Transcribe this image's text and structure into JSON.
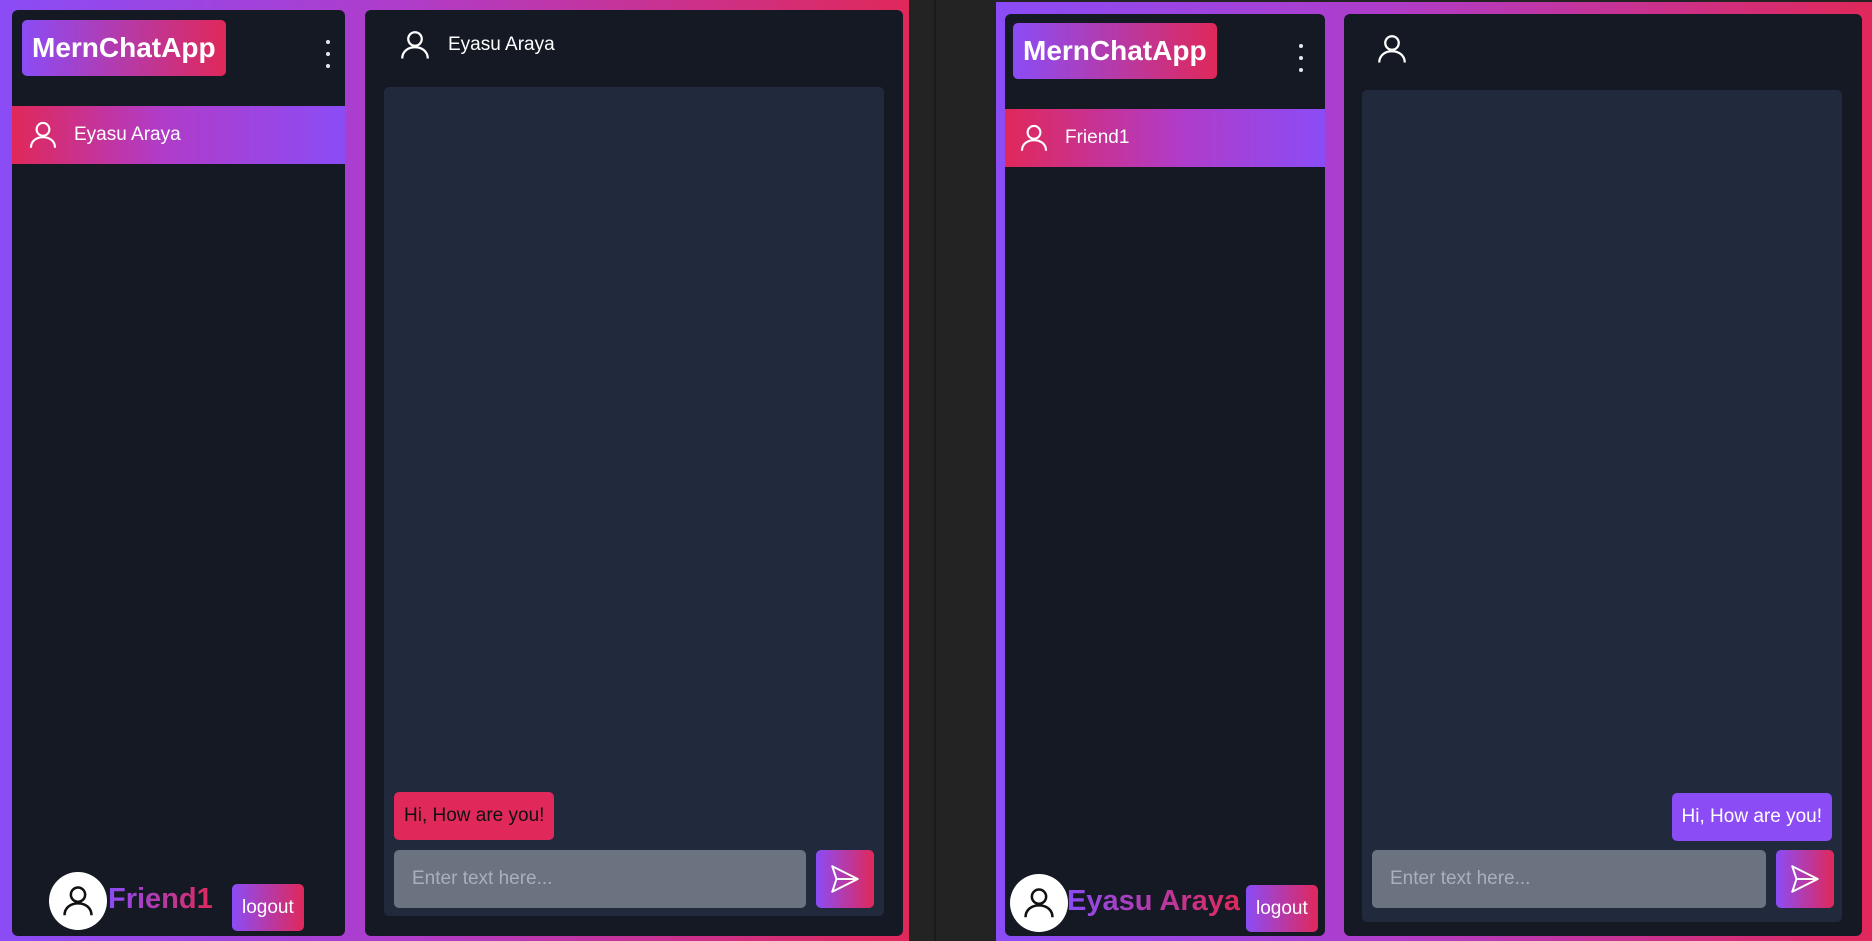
{
  "app_name": "MernChatApp",
  "left_window": {
    "contacts": [
      {
        "name": "Eyasu Araya"
      }
    ],
    "chat": {
      "header_name": "Eyasu Araya",
      "messages": [
        {
          "text": "Hi, How are you!",
          "direction": "received"
        }
      ],
      "input_placeholder": "Enter text here..."
    },
    "current_user": "Friend1",
    "logout_label": "logout"
  },
  "right_window": {
    "contacts": [
      {
        "name": "Friend1"
      }
    ],
    "chat": {
      "header_name": "",
      "messages": [
        {
          "text": "Hi, How are you!",
          "direction": "sent"
        }
      ],
      "input_placeholder": "Enter text here..."
    },
    "current_user": "Eyasu Araya",
    "logout_label": "logout"
  },
  "colors": {
    "gradient_start": "#8b4cf6",
    "gradient_end": "#e0285a",
    "panel_bg": "#141924",
    "chat_area_bg": "#202a3c",
    "input_bg": "#6b7280"
  },
  "icons": {
    "user": "user-outline-icon",
    "menu": "kebab-menu-icon",
    "send": "paper-plane-icon"
  }
}
